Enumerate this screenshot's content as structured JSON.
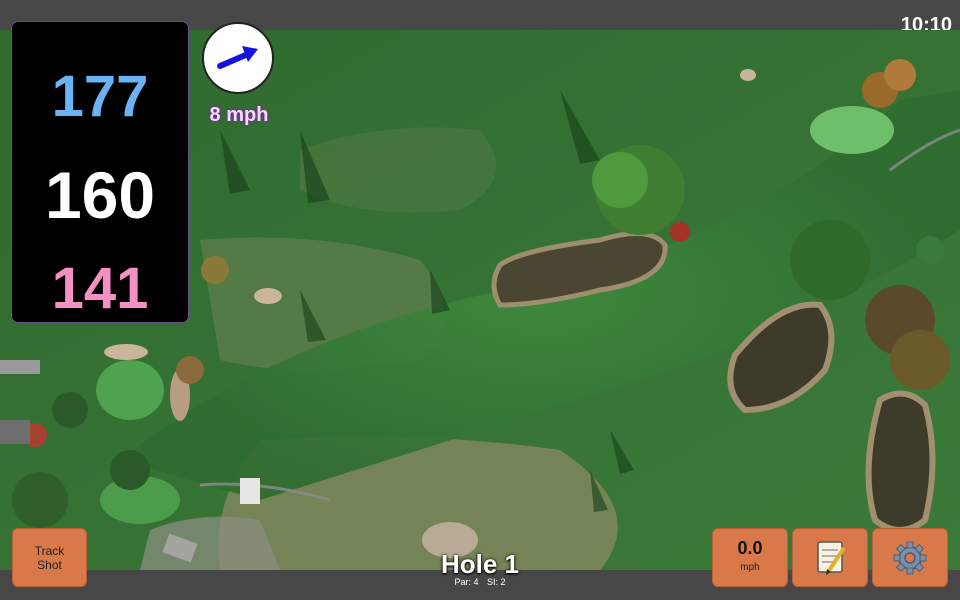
{
  "status_bar": {
    "clock": "10:10"
  },
  "distances": {
    "back": "177",
    "center": "160",
    "front": "141"
  },
  "wind": {
    "speed": "8 mph",
    "direction_icon": "arrow-icon"
  },
  "hole": {
    "title": "Hole 1",
    "par": "Par: 4",
    "stroke_index": "SI: 2"
  },
  "buttons": {
    "track_shot_line1": "Track",
    "track_shot_line2": "Shot",
    "speed_value": "0.0",
    "speed_unit": "mph",
    "notes_icon": "notepad-icon",
    "settings_icon": "gear-icon"
  },
  "colors": {
    "back_distance": "#6ab3f5",
    "center_distance": "#ffffff",
    "front_distance": "#f590c4",
    "button_accent": "#d9794a"
  }
}
